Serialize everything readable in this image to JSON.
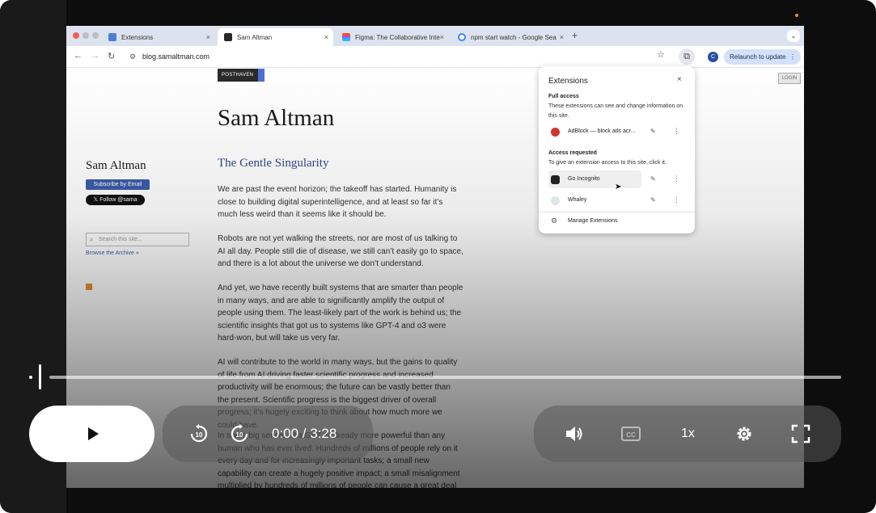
{
  "browser": {
    "tabs": [
      {
        "title": "Extensions",
        "close": "×"
      },
      {
        "title": "Sam Altman",
        "close": "×"
      },
      {
        "title": "Figma: The Collaborative Inte",
        "close": "×"
      },
      {
        "title": "npm start watch - Google Sea",
        "close": "×"
      }
    ],
    "new_tab": "+",
    "tab_menu": "⌄",
    "url": "blog.samaltman.com",
    "profile_initial": "C",
    "relaunch_label": "Relaunch to update"
  },
  "page": {
    "posthaven": "POSTHAVEN",
    "login": "LOGIN",
    "site_title": "Sam Altman",
    "sidebar": {
      "name": "Sam Altman",
      "subscribe": "Subscribe by Email",
      "follow": "𝕏 Follow @sama",
      "search_placeholder": "Search this site...",
      "archive_link": "Browse the Archive »"
    },
    "post_title": "The Gentle Singularity",
    "paragraphs": [
      "We are past the event horizon; the takeoff has started. Humanity is close to building digital superintelligence, and at least so far it’s much less weird than it seems like it should be.",
      "Robots are not yet walking the streets, nor are most of us talking to AI all day. People still die of disease, we still can’t easily go to space, and there is a lot about the universe we don’t understand.",
      "And yet, we have recently built systems that are smarter than people in many ways, and are able to significantly amplify the output of people using them. The least-likely part of the work is behind us; the scientific insights that got us to systems like GPT-4 and o3 were hard-won, but will take us very far.",
      "AI will contribute to the world in many ways, but the gains to quality of life from AI driving faster scientific progress and increased productivity will be enormous; the future can be vastly better than the present. Scientific progress is the biggest driver of overall progress; it’s hugely exciting to think about how much more we could have.",
      "In some big sense, ChatGPT is already more powerful than any human who has ever lived. Hundreds of millions of people rely on it every day and for increasingly important tasks; a small new capability can create a hugely positive impact; a small misalignment multiplied by hundreds of millions of people can cause a great deal of negative"
    ]
  },
  "extensions_popup": {
    "title": "Extensions",
    "close": "×",
    "full_access_heading": "Full access",
    "full_access_desc": "These extensions can see and change information on this site.",
    "full_access_items": [
      {
        "name": "AdBlock — block ads acr..."
      }
    ],
    "requested_heading": "Access requested",
    "requested_desc": "To give an extension access to this site, click it.",
    "requested_items": [
      {
        "name": "Go Incognito"
      },
      {
        "name": "Whaley"
      }
    ],
    "manage": "Manage Extensions"
  },
  "player": {
    "time": "0:00 / 3:28",
    "speed": "1x",
    "progress": 0.0,
    "skip_back_seconds": "10",
    "skip_forward_seconds": "10"
  },
  "colors": {
    "accent_blue": "#3b5ea8",
    "relaunch_bg": "#d3e1fa",
    "player_pill": "#ffffff"
  }
}
